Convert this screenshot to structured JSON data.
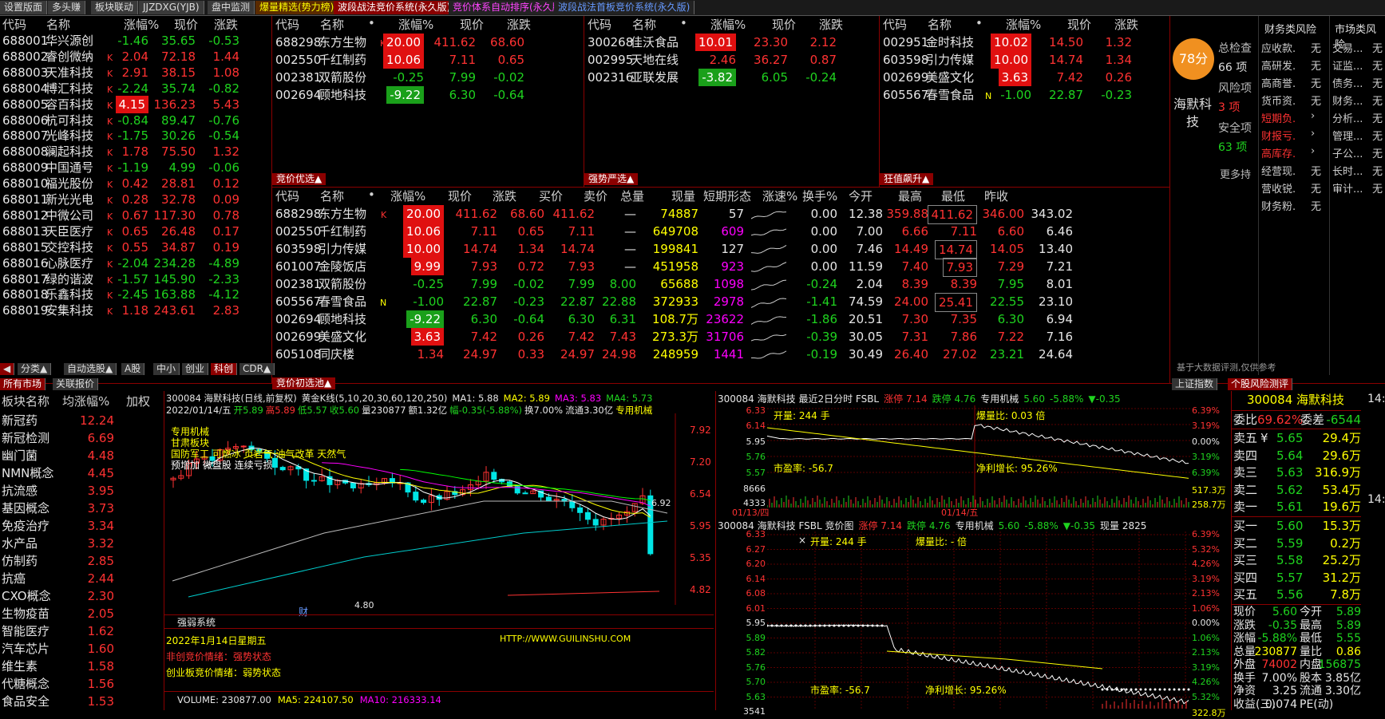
{
  "top_tabs": [
    "设置版面",
    "多头赚",
    "板块联动",
    "JJZDXG(YJB)",
    "盘中监测",
    "爆量精选(势力榜)",
    "波段战法竞价系统(永久版)",
    "竞价体系自动排序(永久版)",
    "波段战法首板竞价系统(永久版)"
  ],
  "list1": {
    "headers": [
      "代码",
      "名称",
      "涨幅%",
      "现价",
      "涨跌"
    ],
    "rows": [
      [
        "688001",
        "华兴源创",
        "",
        "-1.46",
        "35.65",
        "-0.53"
      ],
      [
        "688002",
        "睿创微纳",
        "K",
        "2.04",
        "72.18",
        "1.44"
      ],
      [
        "688003",
        "天准科技",
        "K",
        "2.91",
        "38.15",
        "1.08"
      ],
      [
        "688004",
        "博汇科技",
        "K",
        "-2.24",
        "35.74",
        "-0.82"
      ],
      [
        "688005",
        "容百科技",
        "K",
        "4.15",
        "136.23",
        "5.43"
      ],
      [
        "688006",
        "杭可科技",
        "K",
        "-0.84",
        "89.47",
        "-0.76"
      ],
      [
        "688007",
        "光峰科技",
        "K",
        "-1.75",
        "30.26",
        "-0.54"
      ],
      [
        "688008",
        "澜起科技",
        "K",
        "1.78",
        "75.50",
        "1.32"
      ],
      [
        "688009",
        "中国通号",
        "K",
        "-1.19",
        "4.99",
        "-0.06"
      ],
      [
        "688010",
        "福光股份",
        "K",
        "0.42",
        "28.81",
        "0.12"
      ],
      [
        "688011",
        "新光光电",
        "K",
        "0.28",
        "32.78",
        "0.09"
      ],
      [
        "688012",
        "中微公司",
        "K",
        "0.67",
        "117.30",
        "0.78"
      ],
      [
        "688013",
        "天臣医疗",
        "K",
        "0.65",
        "26.48",
        "0.17"
      ],
      [
        "688015",
        "交控科技",
        "K",
        "0.55",
        "34.87",
        "0.19"
      ],
      [
        "688016",
        "心脉医疗",
        "K",
        "-2.04",
        "234.28",
        "-4.89"
      ],
      [
        "688017",
        "绿的谐波",
        "K",
        "-1.57",
        "145.90",
        "-2.33"
      ],
      [
        "688018",
        "乐鑫科技",
        "K",
        "-2.45",
        "163.88",
        "-4.12"
      ],
      [
        "688019",
        "安集科技",
        "K",
        "1.18",
        "243.61",
        "2.83"
      ]
    ]
  },
  "bottom_tabs1": [
    "分类▲",
    "自动选股▲",
    "A股",
    "中小",
    "创业",
    "科创",
    "CDR▲"
  ],
  "bottom_tabs1b": [
    "所有市场",
    "关联报价"
  ],
  "p1": {
    "headers": [
      "代码",
      "名称",
      "•",
      "涨幅%",
      "现价",
      "涨跌"
    ],
    "rows": [
      [
        "688298",
        "东方生物",
        "K",
        "20.00",
        "411.62",
        "68.60"
      ],
      [
        "002550",
        "千红制药",
        "",
        "10.06",
        "7.11",
        "0.65"
      ],
      [
        "002381",
        "双箭股份",
        "",
        "-0.25",
        "7.99",
        "-0.02"
      ],
      [
        "002694",
        "顾地科技",
        "",
        "-9.22",
        "6.30",
        "-0.64"
      ]
    ],
    "tag": "竞价优选▲"
  },
  "p2": {
    "headers": [
      "代码",
      "名称",
      "•",
      "涨幅%",
      "现价",
      "涨跌"
    ],
    "rows": [
      [
        "300268",
        "佳沃食品",
        "",
        "10.01",
        "23.30",
        "2.12"
      ],
      [
        "002995",
        "天地在线",
        "",
        "2.46",
        "36.27",
        "0.87"
      ],
      [
        "002316",
        "亚联发展",
        "",
        "-3.82",
        "6.05",
        "-0.24"
      ]
    ],
    "tag": "强势严选▲"
  },
  "p3": {
    "headers": [
      "代码",
      "名称",
      "•",
      "涨幅%",
      "现价",
      "涨跌"
    ],
    "rows": [
      [
        "002951",
        "金时科技",
        "",
        "10.02",
        "14.50",
        "1.32"
      ],
      [
        "603598",
        "引力传媒",
        "",
        "10.00",
        "14.74",
        "1.34"
      ],
      [
        "002699",
        "美盛文化",
        "",
        "3.63",
        "7.42",
        "0.26"
      ],
      [
        "605567",
        "春雪食品",
        "N",
        "-1.00",
        "22.87",
        "-0.23"
      ]
    ],
    "tag": "狂值飙升▲"
  },
  "risk": {
    "score": "78分",
    "labels": [
      "总检查",
      "66 项",
      "风险项",
      "3 项",
      "安全项",
      "63 项"
    ],
    "name": "海默科技",
    "more": "更多持",
    "disclaimer": "基于大数据评测,仅供参考",
    "col1_title": "财务类风险",
    "col1": [
      [
        "应收款.",
        "无"
      ],
      [
        "高研发.",
        "无"
      ],
      [
        "高商誉.",
        "无"
      ],
      [
        "货币资.",
        "无"
      ],
      [
        "短期负.",
        "›"
      ],
      [
        "财报亏.",
        "›"
      ],
      [
        "高库存.",
        "›"
      ],
      [
        "经营现.",
        "无"
      ],
      [
        "营收锐.",
        "无"
      ],
      [
        "财务粉.",
        "无"
      ]
    ],
    "col2_title": "市场类风险",
    "col2": [
      [
        "交易...",
        "无"
      ],
      [
        "证监...",
        "无"
      ],
      [
        "债务...",
        "无"
      ],
      [
        "财务...",
        "无"
      ],
      [
        "分析...",
        "无"
      ],
      [
        "管理...",
        "无"
      ],
      [
        "子公...",
        "无"
      ],
      [
        "长时...",
        "无"
      ],
      [
        "审计...",
        "无"
      ]
    ],
    "tabs": [
      "上证指数",
      "个股风险测评"
    ]
  },
  "main": {
    "headers": [
      "代码",
      "名称",
      "•",
      "涨幅%",
      "现价",
      "涨跌",
      "买价",
      "卖价",
      "总量",
      "现量",
      "短期形态",
      "涨速%",
      "换手%",
      "今开",
      "最高",
      "最低",
      "昨收"
    ],
    "rows": [
      [
        "688298",
        "东方生物",
        "K",
        "20.00",
        "411.62",
        "68.60",
        "411.62",
        "—",
        "74887",
        "57",
        "0.00",
        "12.38",
        "359.88",
        "411.62",
        "346.00",
        "343.02"
      ],
      [
        "002550",
        "千红制药",
        "",
        "10.06",
        "7.11",
        "0.65",
        "7.11",
        "—",
        "649708",
        "609",
        "0.00",
        "7.00",
        "6.66",
        "7.11",
        "6.60",
        "6.46"
      ],
      [
        "603598",
        "引力传媒",
        "",
        "10.00",
        "14.74",
        "1.34",
        "14.74",
        "—",
        "199841",
        "127",
        "0.00",
        "7.46",
        "14.49",
        "14.74",
        "14.05",
        "13.40"
      ],
      [
        "601007",
        "金陵饭店",
        "",
        "9.99",
        "7.93",
        "0.72",
        "7.93",
        "—",
        "451958",
        "923",
        "0.00",
        "11.59",
        "7.40",
        "7.93",
        "7.29",
        "7.21"
      ],
      [
        "002381",
        "双箭股份",
        "",
        "-0.25",
        "7.99",
        "-0.02",
        "7.99",
        "8.00",
        "65688",
        "1098",
        "-0.24",
        "2.04",
        "8.39",
        "8.39",
        "7.95",
        "8.01"
      ],
      [
        "605567",
        "春雪食品",
        "N",
        "-1.00",
        "22.87",
        "-0.23",
        "22.87",
        "22.88",
        "372933",
        "2978",
        "-1.41",
        "74.59",
        "24.00",
        "25.41",
        "22.55",
        "23.10"
      ],
      [
        "002694",
        "顾地科技",
        "",
        "-9.22",
        "6.30",
        "-0.64",
        "6.30",
        "6.31",
        "108.7万",
        "23622",
        "-1.86",
        "20.51",
        "7.30",
        "7.35",
        "6.30",
        "6.94"
      ],
      [
        "002699",
        "美盛文化",
        "",
        "3.63",
        "7.42",
        "0.26",
        "7.42",
        "7.43",
        "273.3万",
        "31706",
        "-0.39",
        "30.05",
        "7.31",
        "7.86",
        "7.22",
        "7.16"
      ],
      [
        "605108",
        "同庆楼",
        "",
        "1.34",
        "24.97",
        "0.33",
        "24.97",
        "24.98",
        "248959",
        "1441",
        "-0.19",
        "30.49",
        "26.40",
        "27.02",
        "23.21",
        "24.64"
      ]
    ],
    "tag": "竞价初选池▲"
  },
  "sectors": {
    "headers": [
      "板块名称",
      "均涨幅%",
      "加权"
    ],
    "rows": [
      [
        "新冠药",
        "12.24"
      ],
      [
        "新冠检测",
        "6.69"
      ],
      [
        "幽门菌",
        "4.48"
      ],
      [
        "NMN概念",
        "4.45"
      ],
      [
        "抗流感",
        "3.95"
      ],
      [
        "基因概念",
        "3.73"
      ],
      [
        "免疫治疗",
        "3.34"
      ],
      [
        "水产品",
        "3.32"
      ],
      [
        "仿制药",
        "2.85"
      ],
      [
        "抗癌",
        "2.44"
      ],
      [
        "CXO概念",
        "2.30"
      ],
      [
        "生物疫苗",
        "2.05"
      ],
      [
        "智能医疗",
        "1.62"
      ],
      [
        "汽车芯片",
        "1.60"
      ],
      [
        "维生素",
        "1.58"
      ],
      [
        "代糖概念",
        "1.56"
      ],
      [
        "食品安全",
        "1.53"
      ]
    ]
  },
  "kline": {
    "title": "300084 海默科技(日线,前复权)",
    "ma_name": "黄金K线(5,10,20,30,60,120,250)",
    "ma1": "MA1: 5.88",
    "ma2": "MA2: 5.89",
    "ma3": "MA3: 5.83",
    "ma4": "MA4: 5.73",
    "info_date": "2022/01/14/五",
    "info": [
      "开5.89",
      "高5.89",
      "低5.57",
      "收5.60",
      "量230877",
      "额1.32亿",
      "幅-0.35(-5.88%)",
      "换7.00%",
      "流通3.30亿",
      "专用机械"
    ],
    "y_labels": [
      "7.92",
      "7.20",
      "6.54",
      "5.95",
      "5.35",
      "4.82"
    ],
    "tags": [
      "专用机械",
      "甘肃板块",
      "国防军工 可燃冰 页岩气 油气改革 天然气",
      "预增加 微盘股 连续亏损"
    ],
    "low": "4.80",
    "hi": "6.92",
    "cai": "财"
  },
  "qr": {
    "title": "强弱系统",
    "date": "2022年1月14日星期五",
    "url": "HTTP://WWW.GUILINSHU.COM",
    "line1": "非创竞价情绪：强势状态",
    "line2": "创业板竞价情绪：弱势状态"
  },
  "volbar": {
    "vol": "VOLUME: 230877.00",
    "ma5": "MA5: 224107.50",
    "ma10": "MA10: 216333.14"
  },
  "fs": {
    "title": "300084 海默科技   最近2日分时 FSBL",
    "zt": "涨停 7.14",
    "dt": "跌停 4.76",
    "ind": "专用机械",
    "px": "5.60",
    "chg": "-5.88%",
    "d": "▼-0.35",
    "y_left": [
      "6.33",
      "6.14",
      "5.95",
      "5.76",
      "5.57",
      "8666",
      "4333"
    ],
    "y_right": [
      "6.39%",
      "3.19%",
      "0.00%",
      "3.19%",
      "6.39%",
      "517.3万",
      "258.7万"
    ],
    "open": "开量: 244 手",
    "bl": "爆量比: 0.03 倍",
    "pe": "市盈率: -56.7",
    "np": "净利增长: 95.26%",
    "d1": "01/13/四",
    "d2": "01/14/五"
  },
  "jj": {
    "title": "300084 海默科技   FSBL 竞价图",
    "zt": "涨停 7.14",
    "dt": "跌停 4.76",
    "ind": "专用机械",
    "px": "5.60",
    "chg": "-5.88%",
    "d": "▼-0.35",
    "xl": "现量 2825",
    "y_left": [
      "6.33",
      "6.27",
      "6.20",
      "6.14",
      "6.08",
      "6.01",
      "5.95",
      "5.89",
      "5.82",
      "5.76",
      "5.70",
      "5.63",
      "3541"
    ],
    "y_right": [
      "6.39%",
      "5.32%",
      "4.26%",
      "3.19%",
      "2.13%",
      "1.06%",
      "0.00%",
      "1.06%",
      "2.13%",
      "3.19%",
      "4.26%",
      "5.32%",
      "322.8万"
    ],
    "open": "开量: 244 手",
    "bl": "爆量比: - 倍",
    "pe": "市盈率: -56.7",
    "np": "净利增长: 95.26%",
    "x": "×"
  },
  "quote": {
    "title": "300084 海默科技",
    "wb": [
      "委比",
      "69.62%",
      "委差",
      "-6544"
    ],
    "sell": [
      [
        "卖五",
        "¥",
        "5.65",
        "29.4万"
      ],
      [
        "卖四",
        "",
        "5.64",
        "29.6万"
      ],
      [
        "卖三",
        "",
        "5.63",
        "316.9万"
      ],
      [
        "卖二",
        "",
        "5.62",
        "53.4万"
      ],
      [
        "卖一",
        "",
        "5.61",
        "19.6万"
      ]
    ],
    "buy": [
      [
        "买一",
        "5.60",
        "15.3万"
      ],
      [
        "买二",
        "5.59",
        "0.2万"
      ],
      [
        "买三",
        "5.58",
        "25.2万"
      ],
      [
        "买四",
        "5.57",
        "31.2万"
      ],
      [
        "买五",
        "5.56",
        "7.8万"
      ]
    ],
    "stats": [
      [
        "现价",
        "5.60",
        "今开",
        "5.89"
      ],
      [
        "涨跌",
        "-0.35",
        "最高",
        "5.89"
      ],
      [
        "涨幅",
        "-5.88%",
        "最低",
        "5.55"
      ],
      [
        "总量",
        "230877",
        "量比",
        "0.86"
      ],
      [
        "外盘",
        "74002",
        "内盘",
        "156875"
      ],
      [
        "换手",
        "7.00%",
        "股本",
        "3.85亿"
      ],
      [
        "净资",
        "3.25",
        "流通",
        "3.30亿"
      ],
      [
        "收益(三)",
        "0.074",
        "PE(动)",
        ""
      ]
    ],
    "edge": [
      "14:",
      "14:"
    ]
  },
  "colors": {
    "up": "#ff3232",
    "down": "#1fd31f",
    "frame": "#8b0000",
    "accent": "#ffff00"
  }
}
